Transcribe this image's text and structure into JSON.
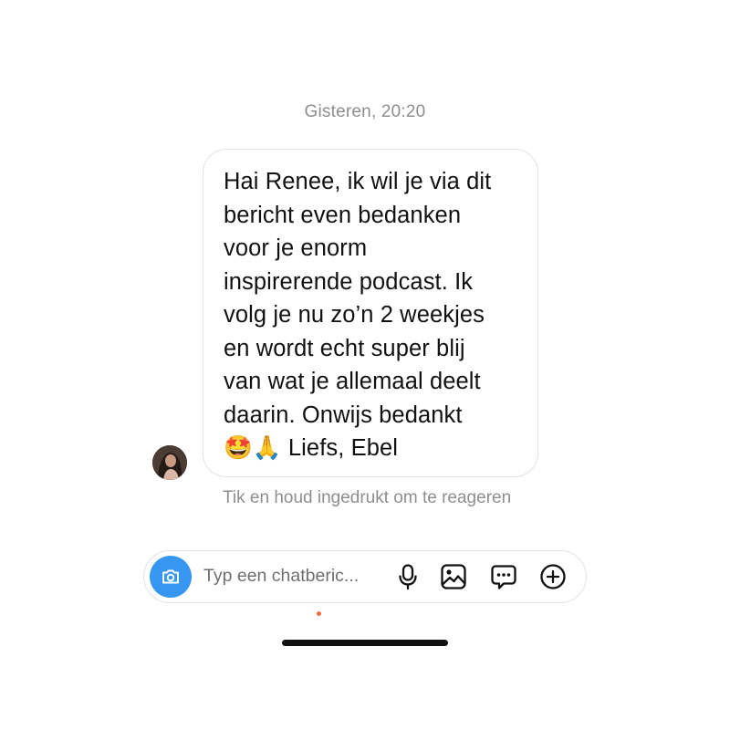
{
  "conversation": {
    "timestamp": "Gisteren, 20:20",
    "message": {
      "text": "Hai Renee, ik wil je via dit\nbericht even bedanken\nvoor je enorm\ninspirerende podcast. Ik\nvolg je nu zo’n 2 weekjes\nen wordt echt super blij\nvan wat je allemaal deelt\ndaarin. Onwijs bedankt\n🤩🙏 Liefs, Ebel"
    },
    "reaction_hint": "Tik en houd ingedrukt om te reageren"
  },
  "composer": {
    "placeholder": "Typ een chatberic...",
    "icons": {
      "camera": "camera-icon",
      "mic": "microphone-icon",
      "gallery": "image-icon",
      "sticker": "sticker-icon",
      "plus": "plus-icon"
    }
  },
  "colors": {
    "accent": "#3797f0",
    "secondary_text": "#8e8e8e",
    "border": "#e3e3e3"
  }
}
